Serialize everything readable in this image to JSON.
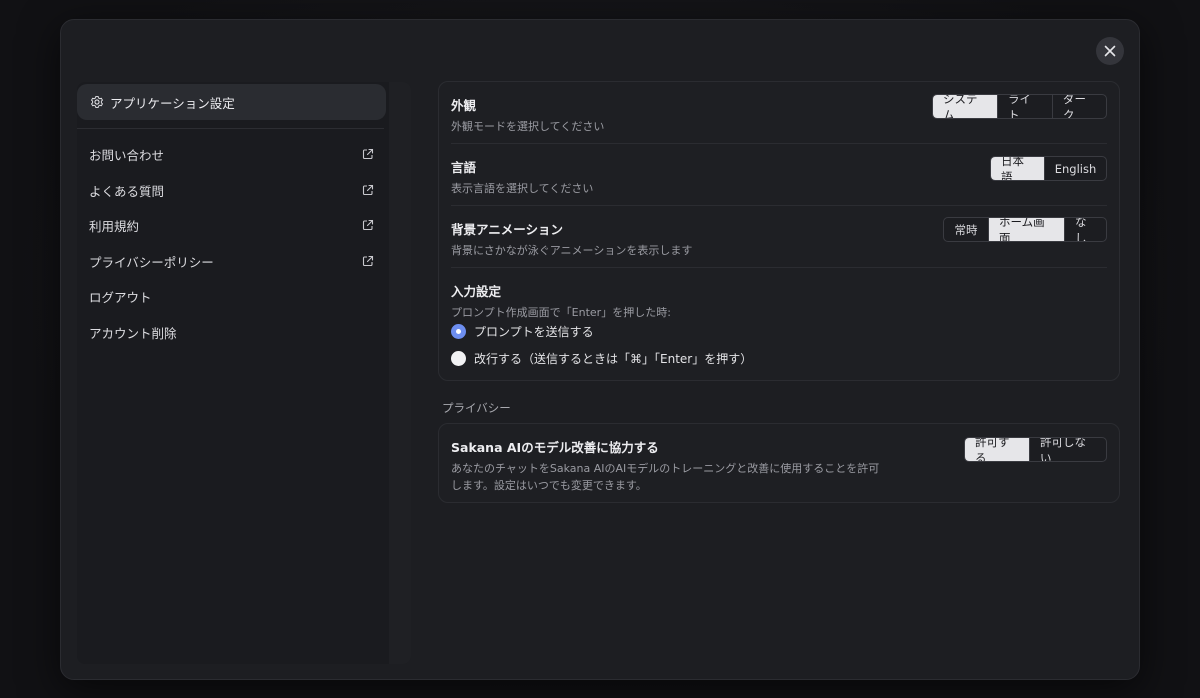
{
  "sidebar": {
    "active_item": {
      "label": "アプリケーション設定",
      "icon": "gear-icon"
    },
    "items": [
      {
        "label": "お問い合わせ",
        "external": true
      },
      {
        "label": "よくある質問",
        "external": true
      },
      {
        "label": "利用規約",
        "external": true
      },
      {
        "label": "プライバシーポリシー",
        "external": true
      },
      {
        "label": "ログアウト",
        "external": false
      },
      {
        "label": "アカウント削除",
        "external": false
      }
    ]
  },
  "settings": {
    "appearance": {
      "title": "外観",
      "description": "外観モードを選択してください",
      "options": [
        "システム",
        "ライト",
        "ダーク"
      ],
      "selected": "システム"
    },
    "language": {
      "title": "言語",
      "description": "表示言語を選択してください",
      "options": [
        "日本語",
        "English"
      ],
      "selected": "日本語"
    },
    "background_animation": {
      "title": "背景アニメーション",
      "description": "背景にさかなが泳ぐアニメーションを表示します",
      "options": [
        "常時",
        "ホーム画面",
        "なし"
      ],
      "selected": "ホーム画面"
    },
    "input": {
      "title": "入力設定",
      "description": "プロンプト作成画面で「Enter」を押した時:",
      "options": [
        {
          "label": "プロンプトを送信する",
          "checked": true
        },
        {
          "label": "改行する（送信するときは「⌘」「Enter」を押す）",
          "checked": false
        }
      ]
    }
  },
  "privacy": {
    "section_label": "プライバシー",
    "model_improvement": {
      "title": "Sakana AIのモデル改善に協力する",
      "description_line1": "あなたのチャットをSakana AIのAIモデルのトレーニングと改善に使用することを許可",
      "description_line2": "します。設定はいつでも変更できます。",
      "options": [
        "許可する",
        "許可しない"
      ],
      "selected": "許可する"
    }
  },
  "colors": {
    "accent": "#6d8ef0",
    "modal_bg": "#1d1e22",
    "segment_active_bg": "#e6e6e9"
  }
}
